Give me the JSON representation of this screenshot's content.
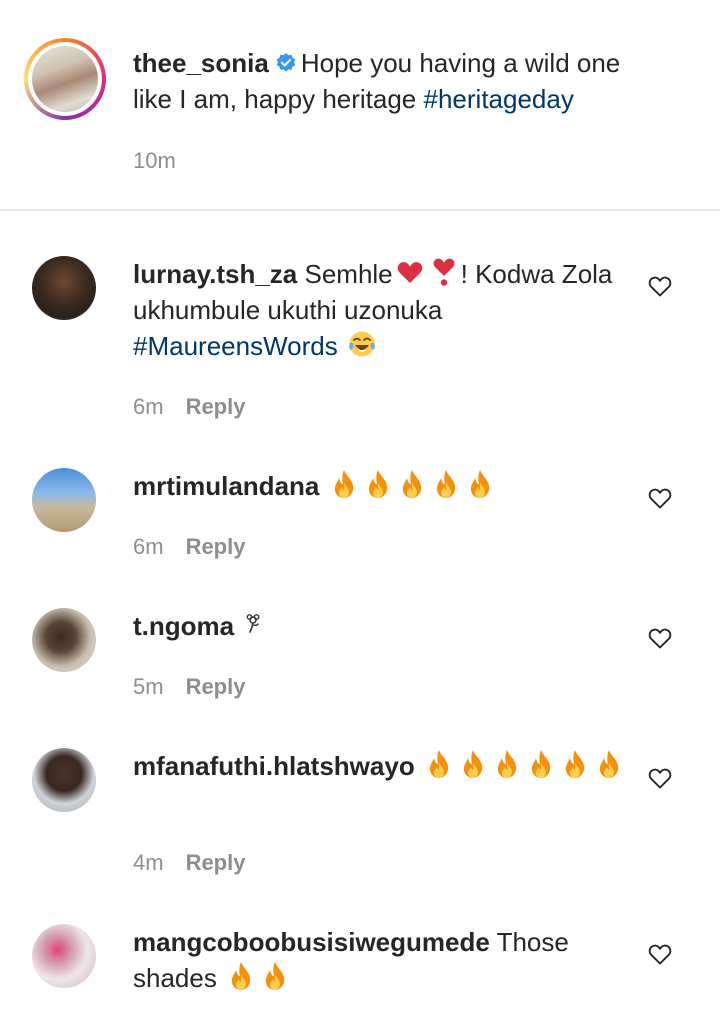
{
  "caption": {
    "username": "thee_sonia",
    "text": "Hope you having a wild one like I am, happy heritage ",
    "hashtag": "#heritageday",
    "time": "10m"
  },
  "comments": [
    {
      "username": "lurnay.tsh_za",
      "text_1": "Semhle",
      "text_2": "! Kodwa Zola ukhumbule ukuthi uzonuka",
      "hashtag": "#MaureensWords",
      "time": "6m",
      "reply_label": "Reply"
    },
    {
      "username": "mrtimulandana",
      "time": "6m",
      "reply_label": "Reply"
    },
    {
      "username": "t.ngoma",
      "time": "5m",
      "reply_label": "Reply"
    },
    {
      "username": "mfanafuthi.hlatshwayo",
      "time": "4m",
      "reply_label": "Reply"
    },
    {
      "username": "mangcoboobusisiwegumede",
      "text": "Those shades"
    }
  ],
  "icons": {
    "verified": "verified-badge-icon",
    "like": "heart-outline-icon",
    "fire": "fire-emoji",
    "red_heart": "red-heart-emoji",
    "exclamation_heart": "heart-exclamation-emoji",
    "laughing": "tears-of-joy-emoji",
    "rosette": "rosette-emoji"
  },
  "colors": {
    "text": "#262626",
    "meta": "#8e8e8e",
    "hashtag": "#00376b",
    "verified": "#3897f0",
    "divider": "#e6e6e6"
  }
}
